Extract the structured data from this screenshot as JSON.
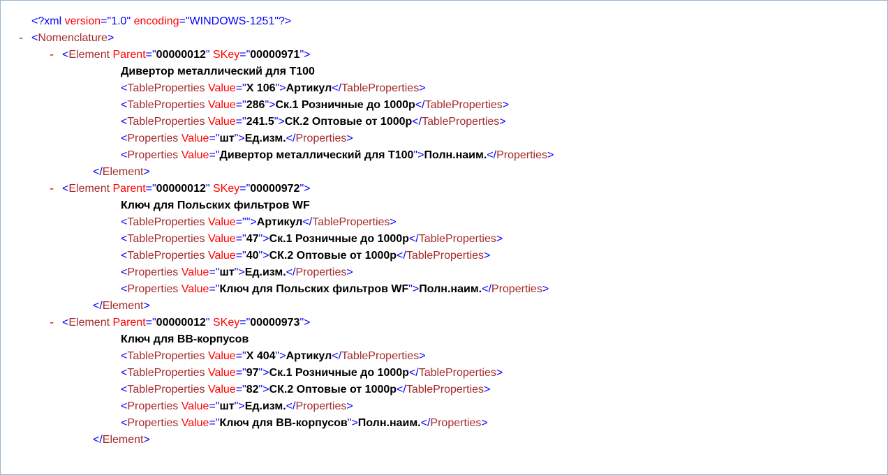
{
  "pi": {
    "version_attr": "version",
    "version_val": "1.0",
    "encoding_attr": "encoding",
    "encoding_val": "WINDOWS-1251"
  },
  "root_tag": "Nomenclature",
  "element_tag": "Element",
  "parent_attr": "Parent",
  "skey_attr": "SKey",
  "tp_tag": "TableProperties",
  "prop_tag": "Properties",
  "value_attr": "Value",
  "elements": [
    {
      "parent": "00000012",
      "skey": "00000971",
      "title": "Дивертор металлический для Т100",
      "tp": [
        {
          "value": "Х 106",
          "text": "Артикул"
        },
        {
          "value": "286",
          "text": "Ск.1 Розничные до 1000р"
        },
        {
          "value": "241.5",
          "text": "СК.2 Оптовые от 1000р"
        }
      ],
      "prop": [
        {
          "value": "шт",
          "text": "Ед.изм."
        },
        {
          "value": "Дивертор металлический для Т100",
          "text": "Полн.наим."
        }
      ]
    },
    {
      "parent": "00000012",
      "skey": "00000972",
      "title": "Ключ для Польских фильтров WF",
      "tp": [
        {
          "value": "",
          "text": "Артикул"
        },
        {
          "value": "47",
          "text": "Ск.1 Розничные до 1000р"
        },
        {
          "value": "40",
          "text": "СК.2 Оптовые от 1000р"
        }
      ],
      "prop": [
        {
          "value": "шт",
          "text": "Ед.изм."
        },
        {
          "value": "Ключ для Польских фильтров WF",
          "text": "Полн.наим."
        }
      ]
    },
    {
      "parent": "00000012",
      "skey": "00000973",
      "title": "Ключ для ВВ-корпусов",
      "tp": [
        {
          "value": "Х 404",
          "text": "Артикул"
        },
        {
          "value": "97",
          "text": "Ск.1 Розничные до 1000р"
        },
        {
          "value": "82",
          "text": "СК.2 Оптовые от 1000р"
        }
      ],
      "prop": [
        {
          "value": "шт",
          "text": "Ед.изм."
        },
        {
          "value": "Ключ для ВВ-корпусов",
          "text": "Полн.наим."
        }
      ]
    }
  ]
}
